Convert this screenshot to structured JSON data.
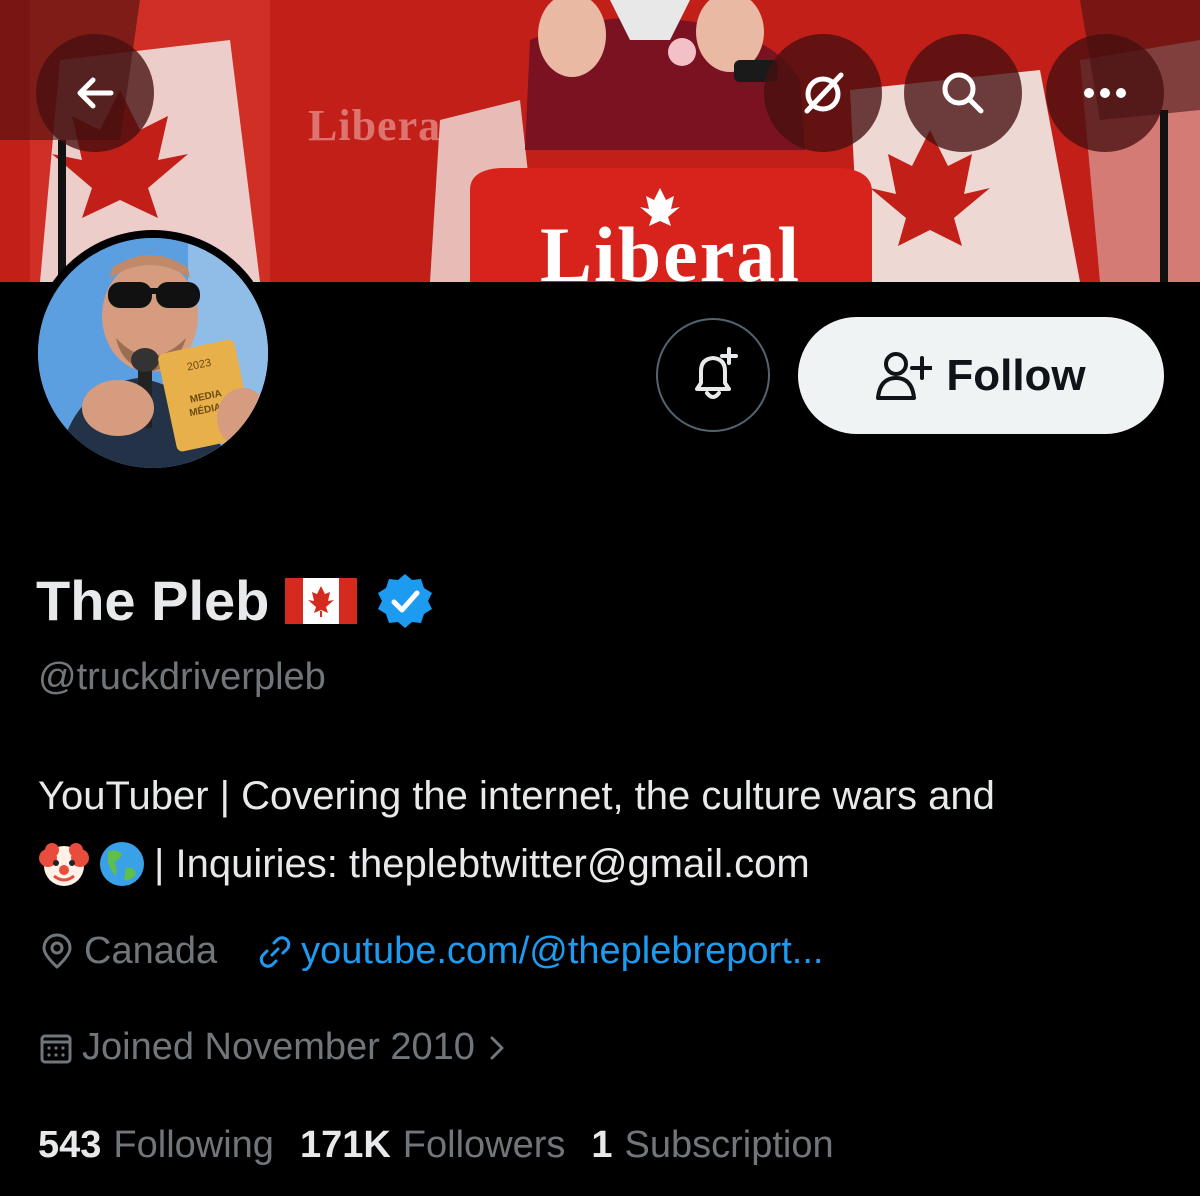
{
  "banner": {
    "brand_back": "Libera",
    "podium": "Liberal"
  },
  "header": {
    "back_icon": "arrow-left-icon",
    "grok_icon": "slash-circle-icon",
    "search_icon": "search-icon",
    "more_icon": "more-horizontal-icon"
  },
  "avatar": {
    "badge_year": "2023",
    "badge_line1": "MEDIA",
    "badge_line2": "MÉDIAS"
  },
  "actions": {
    "notify_icon": "bell-plus-icon",
    "follow_label": "Follow"
  },
  "profile": {
    "name": "The Pleb",
    "handle": "@truckdriverpleb",
    "bio_line1": "YouTuber | Covering the internet, the culture wars and",
    "bio_line2": " | Inquiries: theplebtwitter@gmail.com",
    "location": "Canada",
    "link": "youtube.com/@theplebreport...",
    "joined": "Joined November 2010",
    "verified_color": "#1d9bf0"
  },
  "stats": {
    "following_count": "543",
    "following_label": "Following",
    "followers_count": "171K",
    "followers_label": "Followers",
    "subscriptions_count": "1",
    "subscriptions_label": "Subscription"
  },
  "colors": {
    "background": "#000000",
    "text_primary": "#e7e9ea",
    "text_secondary": "#71767b",
    "link": "#1d9bf0",
    "follow_button": "#eff3f4",
    "banner_red": "#c8231c"
  }
}
